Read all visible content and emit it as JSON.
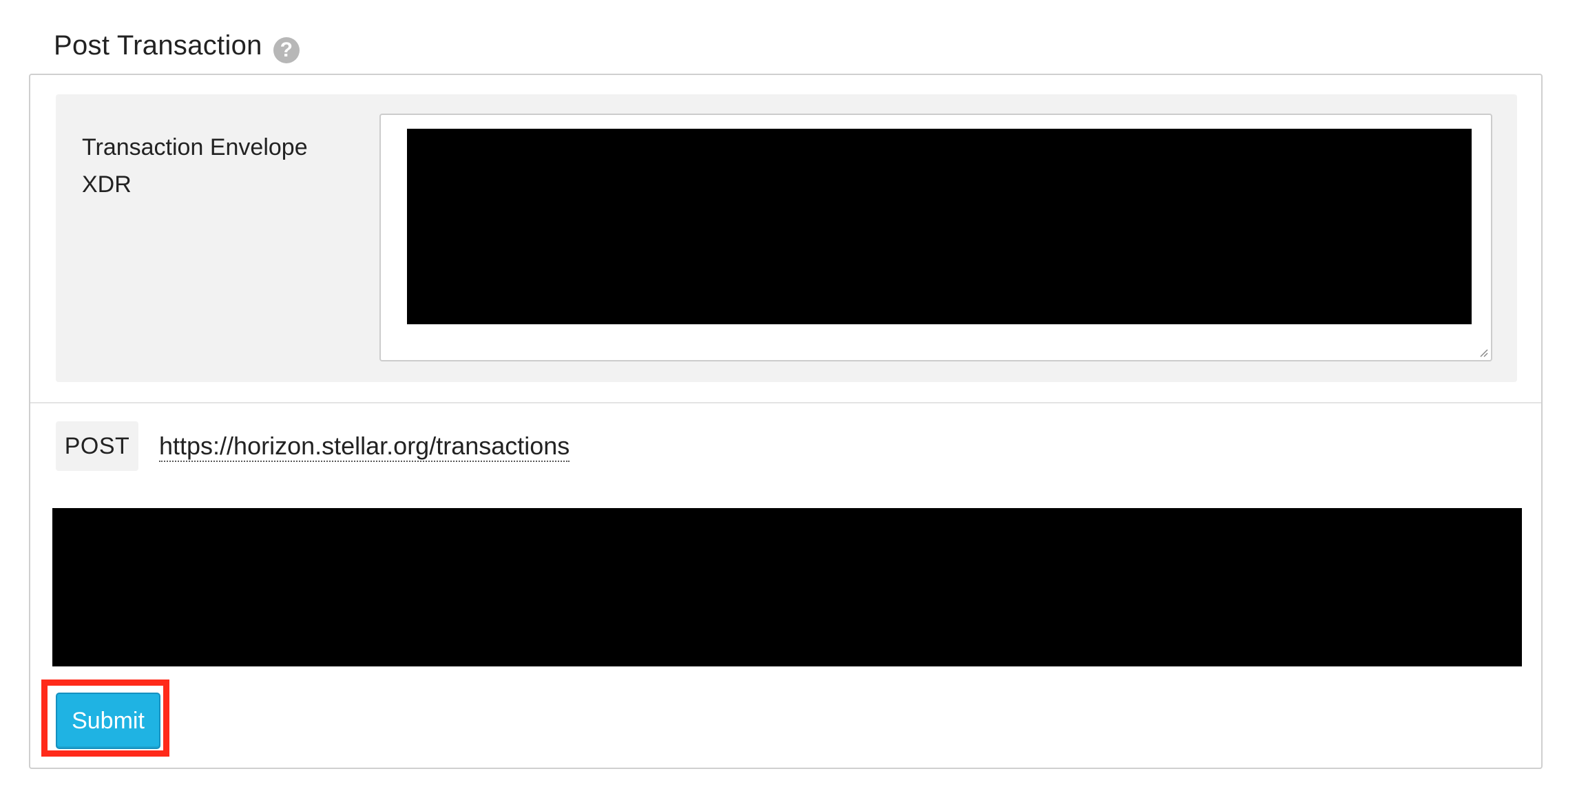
{
  "header": {
    "title": "Post Transaction",
    "help_icon": "question-mark-icon",
    "help_glyph": "?"
  },
  "form": {
    "envelope_label": "Transaction Envelope XDR",
    "envelope_value": "[redacted]"
  },
  "request": {
    "method": "POST",
    "url": "https://horizon.stellar.org/transactions"
  },
  "response": {
    "content": "[redacted]"
  },
  "actions": {
    "submit_label": "Submit"
  },
  "colors": {
    "submit_button": "#1fb3e3",
    "highlight_border": "#ff2a1a",
    "field_background": "#f2f2f2",
    "redaction": "#000000"
  }
}
